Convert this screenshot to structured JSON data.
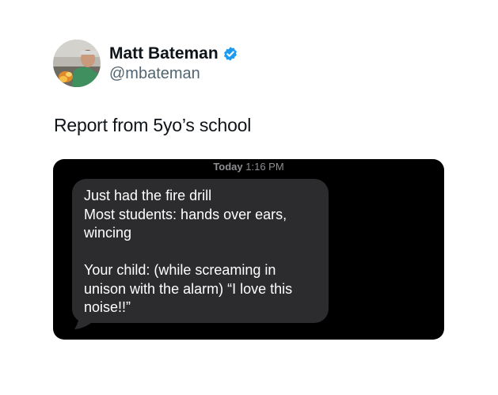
{
  "author": {
    "display_name": "Matt Bateman",
    "handle": "@mbateman",
    "avatar_icon": "avatar-photo",
    "verified_icon": "verified-badge-icon",
    "verified_color": "#1d9bf0"
  },
  "tweet": {
    "text": "Report from 5yo’s school"
  },
  "embedded_screenshot": {
    "timestamp_day": "Today",
    "timestamp_time": "1:16 PM",
    "message": "Just had the fire drill\nMost students: hands over ears, wincing\n\nYour child: (while screaming in unison with the alarm) “I love this noise!!”",
    "bubble_color": "#2c2c2e",
    "background_color": "#000000"
  }
}
